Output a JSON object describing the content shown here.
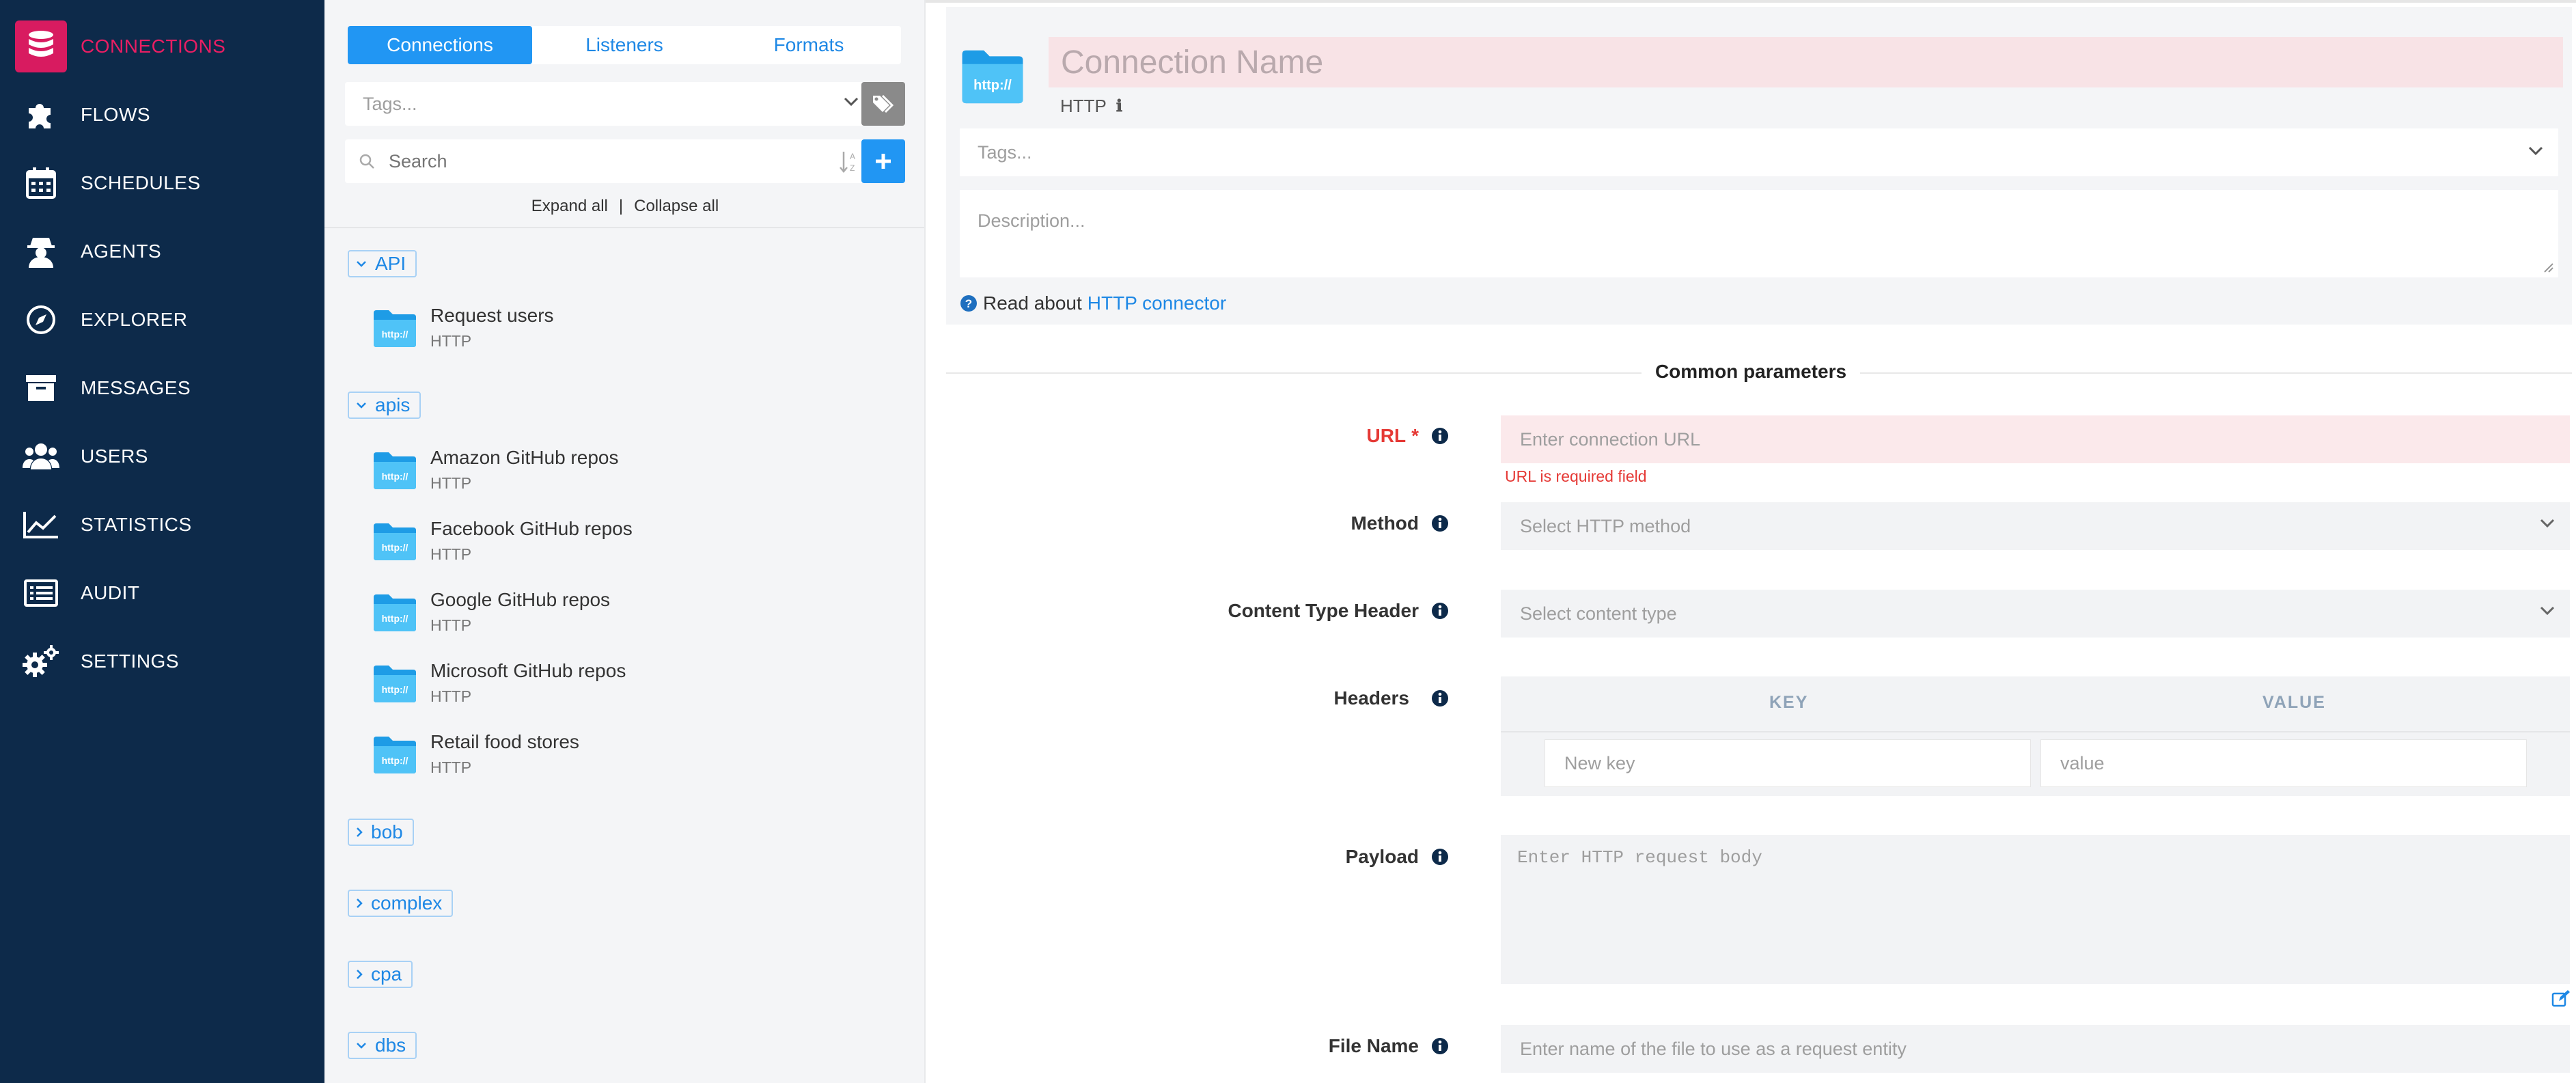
{
  "sidebar": {
    "items": [
      {
        "label": "CONNECTIONS",
        "icon": "database-icon",
        "active": true
      },
      {
        "label": "FLOWS",
        "icon": "puzzle-icon",
        "active": false
      },
      {
        "label": "SCHEDULES",
        "icon": "calendar-icon",
        "active": false
      },
      {
        "label": "AGENTS",
        "icon": "agent-icon",
        "active": false
      },
      {
        "label": "EXPLORER",
        "icon": "compass-icon",
        "active": false
      },
      {
        "label": "MESSAGES",
        "icon": "archive-icon",
        "active": false
      },
      {
        "label": "USERS",
        "icon": "users-icon",
        "active": false
      },
      {
        "label": "STATISTICS",
        "icon": "chart-line-icon",
        "active": false
      },
      {
        "label": "AUDIT",
        "icon": "list-icon",
        "active": false
      },
      {
        "label": "SETTINGS",
        "icon": "gears-icon",
        "active": false
      }
    ]
  },
  "list_panel": {
    "tabs": [
      {
        "label": "Connections",
        "active": true
      },
      {
        "label": "Listeners",
        "active": false
      },
      {
        "label": "Formats",
        "active": false
      }
    ],
    "tags_placeholder": "Tags...",
    "search_placeholder": "Search",
    "expand_all": "Expand all",
    "separator": "|",
    "collapse_all": "Collapse all",
    "groups": [
      {
        "name": "API",
        "expanded": true,
        "items": [
          {
            "name": "Request users",
            "type": "HTTP"
          }
        ]
      },
      {
        "name": "apis",
        "expanded": true,
        "items": [
          {
            "name": "Amazon GitHub repos",
            "type": "HTTP"
          },
          {
            "name": "Facebook GitHub repos",
            "type": "HTTP"
          },
          {
            "name": "Google GitHub repos",
            "type": "HTTP"
          },
          {
            "name": "Microsoft GitHub repos",
            "type": "HTTP"
          },
          {
            "name": "Retail food stores",
            "type": "HTTP"
          }
        ]
      },
      {
        "name": "bob",
        "expanded": false,
        "items": []
      },
      {
        "name": "complex",
        "expanded": false,
        "items": []
      },
      {
        "name": "cpa",
        "expanded": false,
        "items": []
      },
      {
        "name": "dbs",
        "expanded": true,
        "items": []
      }
    ],
    "folder_icon_text": "http://"
  },
  "form": {
    "icon_text": "http://",
    "name_placeholder": "Connection Name",
    "type": "HTTP",
    "type_info": "ℹ",
    "tags_placeholder": "Tags...",
    "description_placeholder": "Description...",
    "read_about_prefix": "Read about",
    "read_about_link": "HTTP connector",
    "section_title": "Common parameters",
    "url": {
      "label": "URL",
      "required_mark": "*",
      "placeholder": "Enter connection URL",
      "error": "URL is required field"
    },
    "method": {
      "label": "Method",
      "placeholder": "Select HTTP method"
    },
    "content_type": {
      "label": "Content Type Header",
      "placeholder": "Select content type"
    },
    "headers": {
      "label": "Headers",
      "key_col": "KEY",
      "value_col": "VALUE",
      "key_placeholder": "New key",
      "value_placeholder": "value"
    },
    "payload": {
      "label": "Payload",
      "placeholder": "Enter HTTP request body"
    },
    "file_name": {
      "label": "File Name",
      "placeholder": "Enter name of the file to use as a request entity"
    }
  },
  "colors": {
    "sidebar_bg": "#0d2a4a",
    "accent_pink": "#e91e63",
    "accent_blue": "#2196f3",
    "error_red": "#e53935"
  }
}
